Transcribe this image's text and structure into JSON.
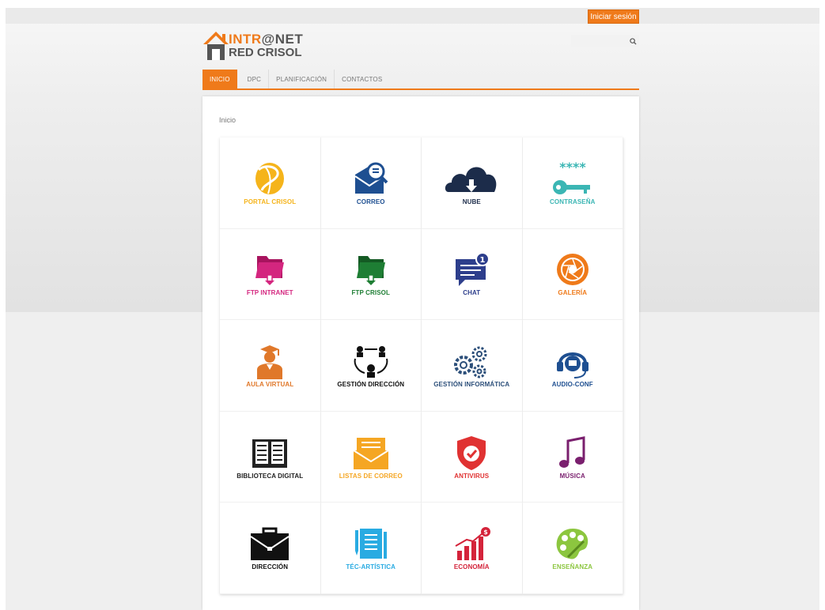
{
  "header": {
    "login_label": "Iniciar sesión",
    "logo_line1_a": "INTR",
    "logo_line1_b": "@NET",
    "logo_line2": "RED CRISOL",
    "search_placeholder": ""
  },
  "nav": {
    "items": [
      "INICIO",
      "DPC",
      "PLANIFICACIÓN",
      "CONTACTOS"
    ]
  },
  "main": {
    "breadcrumb": "Inicio"
  },
  "tiles": [
    {
      "label": "PORTAL CRISOL",
      "icon": "globe-icon",
      "color": "#f5b41b"
    },
    {
      "label": "CORREO",
      "icon": "mail-search-icon",
      "color": "#1e4f91"
    },
    {
      "label": "NUBE",
      "icon": "cloud-download-icon",
      "color": "#1c2c4a"
    },
    {
      "label": "CONTRASEÑA",
      "icon": "key-password-icon",
      "color": "#3bb6b4"
    },
    {
      "label": "FTP INTRANET",
      "icon": "folder-download-icon",
      "color": "#d4267f"
    },
    {
      "label": "FTP CRISOL",
      "icon": "folder-download-icon",
      "color": "#1e7e34"
    },
    {
      "label": "CHAT",
      "icon": "chat-icon",
      "color": "#2d3e8c"
    },
    {
      "label": "GALERÍA",
      "icon": "camera-shutter-icon",
      "color": "#ef7a1a"
    },
    {
      "label": "AULA VIRTUAL",
      "icon": "graduate-icon",
      "color": "#e0782a"
    },
    {
      "label": "GESTIÓN DIRECCIÓN",
      "icon": "team-cycle-icon",
      "color": "#111111"
    },
    {
      "label": "GESTIÓN INFORMÁTICA",
      "icon": "gears-icon",
      "color": "#2c4f7a"
    },
    {
      "label": "AUDIO-CONF",
      "icon": "headset-icon",
      "color": "#1e4f91"
    },
    {
      "label": "BIBLIOTECA DIGITAL",
      "icon": "book-icon",
      "color": "#222222"
    },
    {
      "label": "LISTAS DE CORREO",
      "icon": "envelope-list-icon",
      "color": "#f5a623"
    },
    {
      "label": "ANTIVIRUS",
      "icon": "shield-check-icon",
      "color": "#e03232"
    },
    {
      "label": "MÚSICA",
      "icon": "music-note-icon",
      "color": "#7a1f6e"
    },
    {
      "label": "DIRECCIÓN",
      "icon": "briefcase-icon",
      "color": "#111111"
    },
    {
      "label": "TÉC-ARTÍSTICA",
      "icon": "document-pencil-icon",
      "color": "#29abe2"
    },
    {
      "label": "ECONOMÍA",
      "icon": "bar-growth-icon",
      "color": "#d4233a"
    },
    {
      "label": "ENSEÑANZA",
      "icon": "palette-icon",
      "color": "#8cc63f"
    }
  ],
  "colors": {
    "accent": "#ef7a1a"
  }
}
